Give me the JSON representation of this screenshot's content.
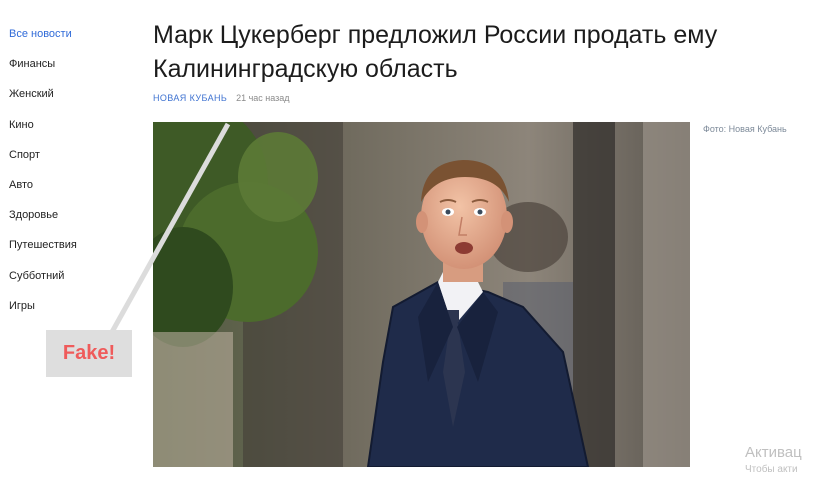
{
  "sidebar": {
    "items": [
      {
        "label": "Все новости",
        "active": true
      },
      {
        "label": "Финансы"
      },
      {
        "label": "Женский"
      },
      {
        "label": "Кино"
      },
      {
        "label": "Спорт"
      },
      {
        "label": "Авто"
      },
      {
        "label": "Здоровье"
      },
      {
        "label": "Путешествия"
      },
      {
        "label": "Субботний"
      },
      {
        "label": "Игры"
      }
    ]
  },
  "article": {
    "title": "Марк Цукерберг предложил России продать ему Калининградскую область",
    "source": "НОВАЯ КУБАНЬ",
    "time": "21 час назад",
    "photo_credit": "Фото: Новая Кубань"
  },
  "annotation": {
    "label": "Fake!",
    "color": "#ef5b5b"
  },
  "watermark": {
    "title": "Активац",
    "subtitle": "Чтобы акти"
  },
  "colors": {
    "accent": "#3f73d1",
    "active_link": "#2f6ad8"
  }
}
